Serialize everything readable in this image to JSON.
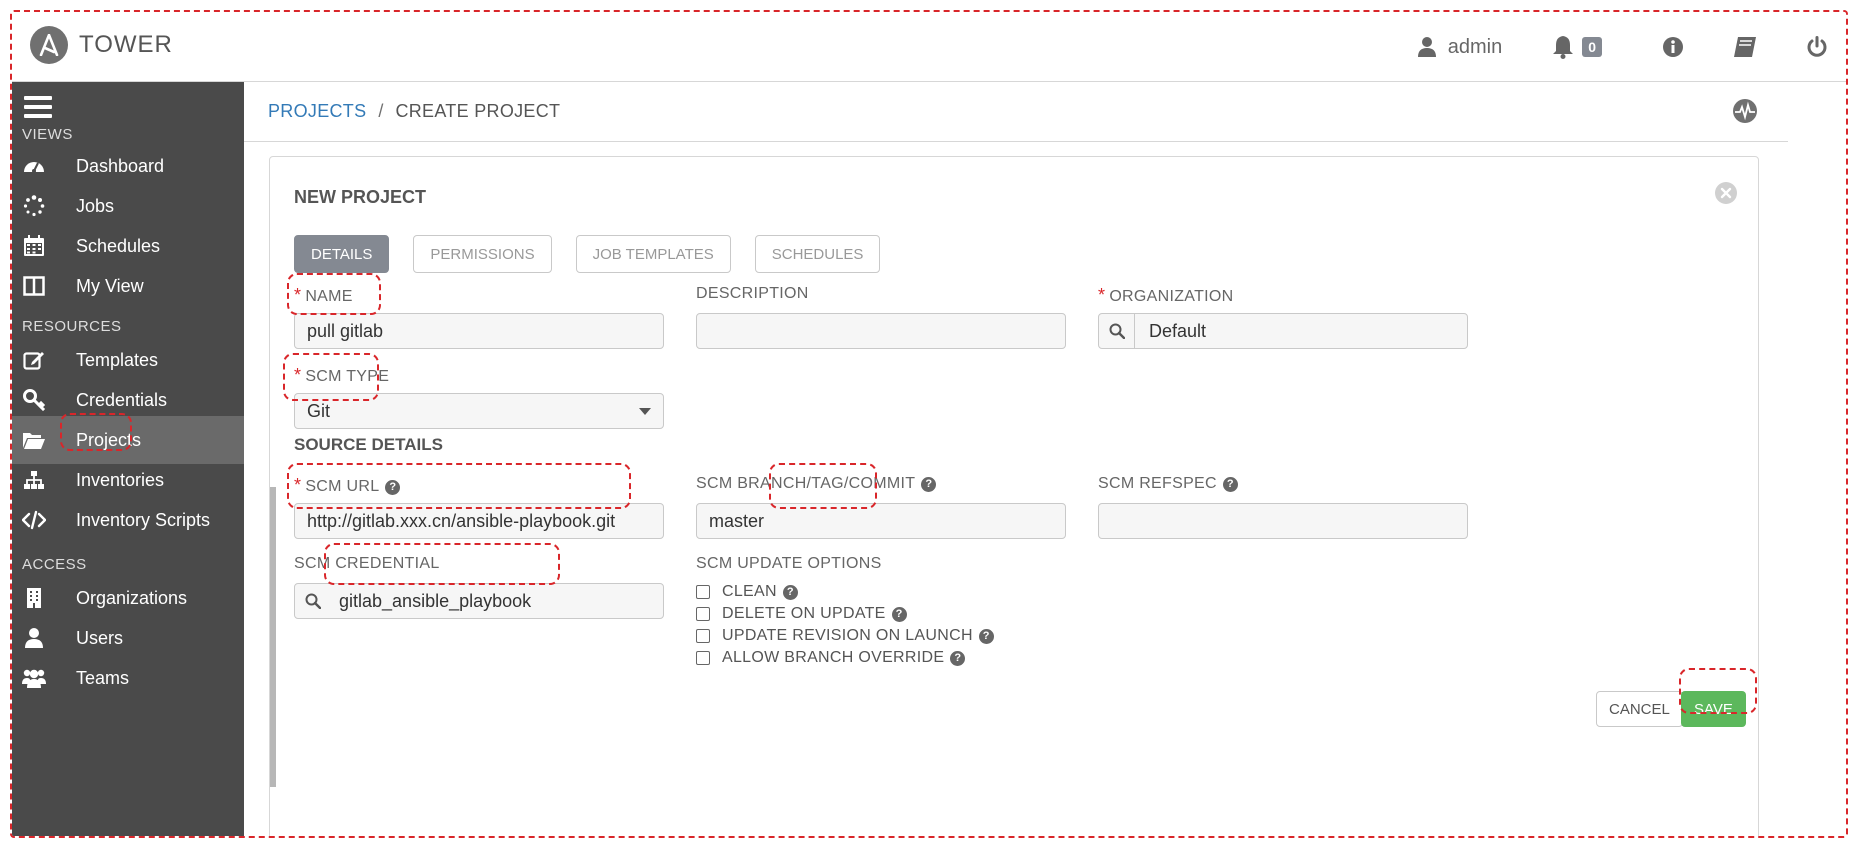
{
  "app": {
    "name": "TOWER",
    "user": "admin",
    "notification_count": "0"
  },
  "sidebar": {
    "sections": {
      "views": "VIEWS",
      "resources": "RESOURCES",
      "access": "ACCESS"
    },
    "items": [
      {
        "label": "Dashboard",
        "icon": "dashboard-icon"
      },
      {
        "label": "Jobs",
        "icon": "spinner-icon"
      },
      {
        "label": "Schedules",
        "icon": "calendar-icon"
      },
      {
        "label": "My View",
        "icon": "columns-icon"
      },
      {
        "label": "Templates",
        "icon": "edit-icon"
      },
      {
        "label": "Credentials",
        "icon": "key-icon"
      },
      {
        "label": "Projects",
        "icon": "folder-open-icon",
        "active": true
      },
      {
        "label": "Inventories",
        "icon": "sitemap-icon"
      },
      {
        "label": "Inventory Scripts",
        "icon": "code-icon"
      },
      {
        "label": "Organizations",
        "icon": "building-icon"
      },
      {
        "label": "Users",
        "icon": "user-icon"
      },
      {
        "label": "Teams",
        "icon": "users-icon"
      }
    ]
  },
  "breadcrumb": {
    "parent": "PROJECTS",
    "separator": "/",
    "current": "CREATE PROJECT"
  },
  "panel": {
    "title": "NEW PROJECT",
    "tabs": [
      "DETAILS",
      "PERMISSIONS",
      "JOB TEMPLATES",
      "SCHEDULES"
    ],
    "active_tab": "DETAILS"
  },
  "form": {
    "name_label": "NAME",
    "name_value": "pull gitlab",
    "description_label": "DESCRIPTION",
    "description_value": "",
    "organization_label": "ORGANIZATION",
    "organization_value": "Default",
    "scm_type_label": "SCM TYPE",
    "scm_type_value": "Git",
    "source_details_title": "SOURCE DETAILS",
    "scm_url_label": "SCM URL",
    "scm_url_value": "http://gitlab.xxx.cn/ansible-playbook.git",
    "scm_branch_label": "SCM BRANCH/TAG/COMMIT",
    "scm_branch_value": "master",
    "scm_refspec_label": "SCM REFSPEC",
    "scm_refspec_value": "",
    "scm_credential_label": "SCM CREDENTIAL",
    "scm_credential_value": "gitlab_ansible_playbook",
    "update_options_label": "SCM UPDATE OPTIONS",
    "update_options": [
      {
        "label": "CLEAN",
        "checked": false
      },
      {
        "label": "DELETE ON UPDATE",
        "checked": false
      },
      {
        "label": "UPDATE REVISION ON LAUNCH",
        "checked": false
      },
      {
        "label": "ALLOW BRANCH OVERRIDE",
        "checked": false
      }
    ]
  },
  "actions": {
    "cancel": "CANCEL",
    "save": "SAVE"
  },
  "colors": {
    "sidebar_bg": "#4a4a4a",
    "active_tab": "#848992",
    "link": "#337ab7",
    "save": "#5cb85c",
    "required": "#d9262a",
    "annotation": "#d9262a"
  }
}
